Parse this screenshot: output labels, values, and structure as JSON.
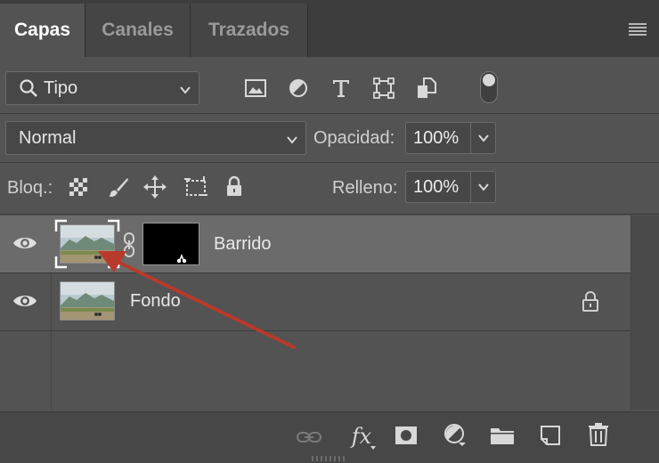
{
  "tabs": [
    {
      "label": "Capas",
      "active": true
    },
    {
      "label": "Canales",
      "active": false
    },
    {
      "label": "Trazados",
      "active": false
    }
  ],
  "filter": {
    "kind_label": "Tipo",
    "icons": [
      "image-filter-icon",
      "adjustment-filter-icon",
      "type-filter-icon",
      "shape-filter-icon",
      "smart-object-filter-icon"
    ]
  },
  "blend": {
    "mode": "Normal",
    "opacity_label": "Opacidad:",
    "opacity_value": "100%"
  },
  "lock": {
    "label": "Bloq.:",
    "fill_label": "Relleno:",
    "fill_value": "100%"
  },
  "layers": [
    {
      "name": "Barrido",
      "selected": true,
      "has_mask": true,
      "locked": false
    },
    {
      "name": "Fondo",
      "selected": false,
      "has_mask": false,
      "locked": true
    }
  ],
  "bottom_actions": [
    "link-layers-icon",
    "fx-icon",
    "add-mask-icon",
    "adjustment-layer-icon",
    "new-group-icon",
    "new-layer-icon",
    "delete-icon"
  ],
  "bottom_fx_label": "fx",
  "colors": {
    "panel": "#535353",
    "selected_row": "#6b6b6b",
    "annotation_arrow": "#b83a2a"
  }
}
